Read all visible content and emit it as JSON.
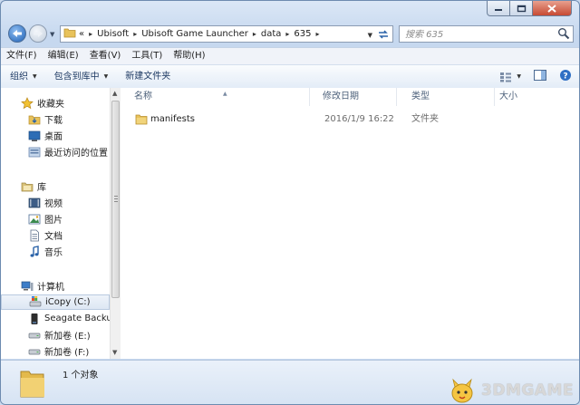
{
  "address": {
    "history_glyph": "«",
    "crumbs": [
      "Ubisoft",
      "Ubisoft Game Launcher",
      "data",
      "635"
    ],
    "separator": "▸"
  },
  "search": {
    "placeholder": "搜索 635"
  },
  "menu": [
    "文件(F)",
    "编辑(E)",
    "查看(V)",
    "工具(T)",
    "帮助(H)"
  ],
  "toolbar": {
    "organize": "组织",
    "include": "包含到库中",
    "new_folder": "新建文件夹"
  },
  "nav": {
    "favorites": {
      "label": "收藏夹",
      "items": [
        "下载",
        "桌面",
        "最近访问的位置"
      ]
    },
    "libraries": {
      "label": "库",
      "items": [
        "视频",
        "图片",
        "文档",
        "音乐"
      ]
    },
    "computer": {
      "label": "计算机",
      "items": [
        "iCopy (C:)",
        "Seagate Backup",
        "新加卷 (E:)",
        "新加卷 (F:)"
      ]
    }
  },
  "columns": {
    "name": "名称",
    "modified": "修改日期",
    "type": "类型",
    "size": "大小"
  },
  "files": [
    {
      "name": "manifests",
      "modified": "2016/1/9 16:22",
      "type": "文件夹",
      "size": ""
    }
  ],
  "status": {
    "count": "1 个对象"
  },
  "watermark": {
    "text": "3DMGAME"
  },
  "colors": {
    "folder": "#e8c25a",
    "accent": "#1d5fb4",
    "close": "#c74a33"
  }
}
